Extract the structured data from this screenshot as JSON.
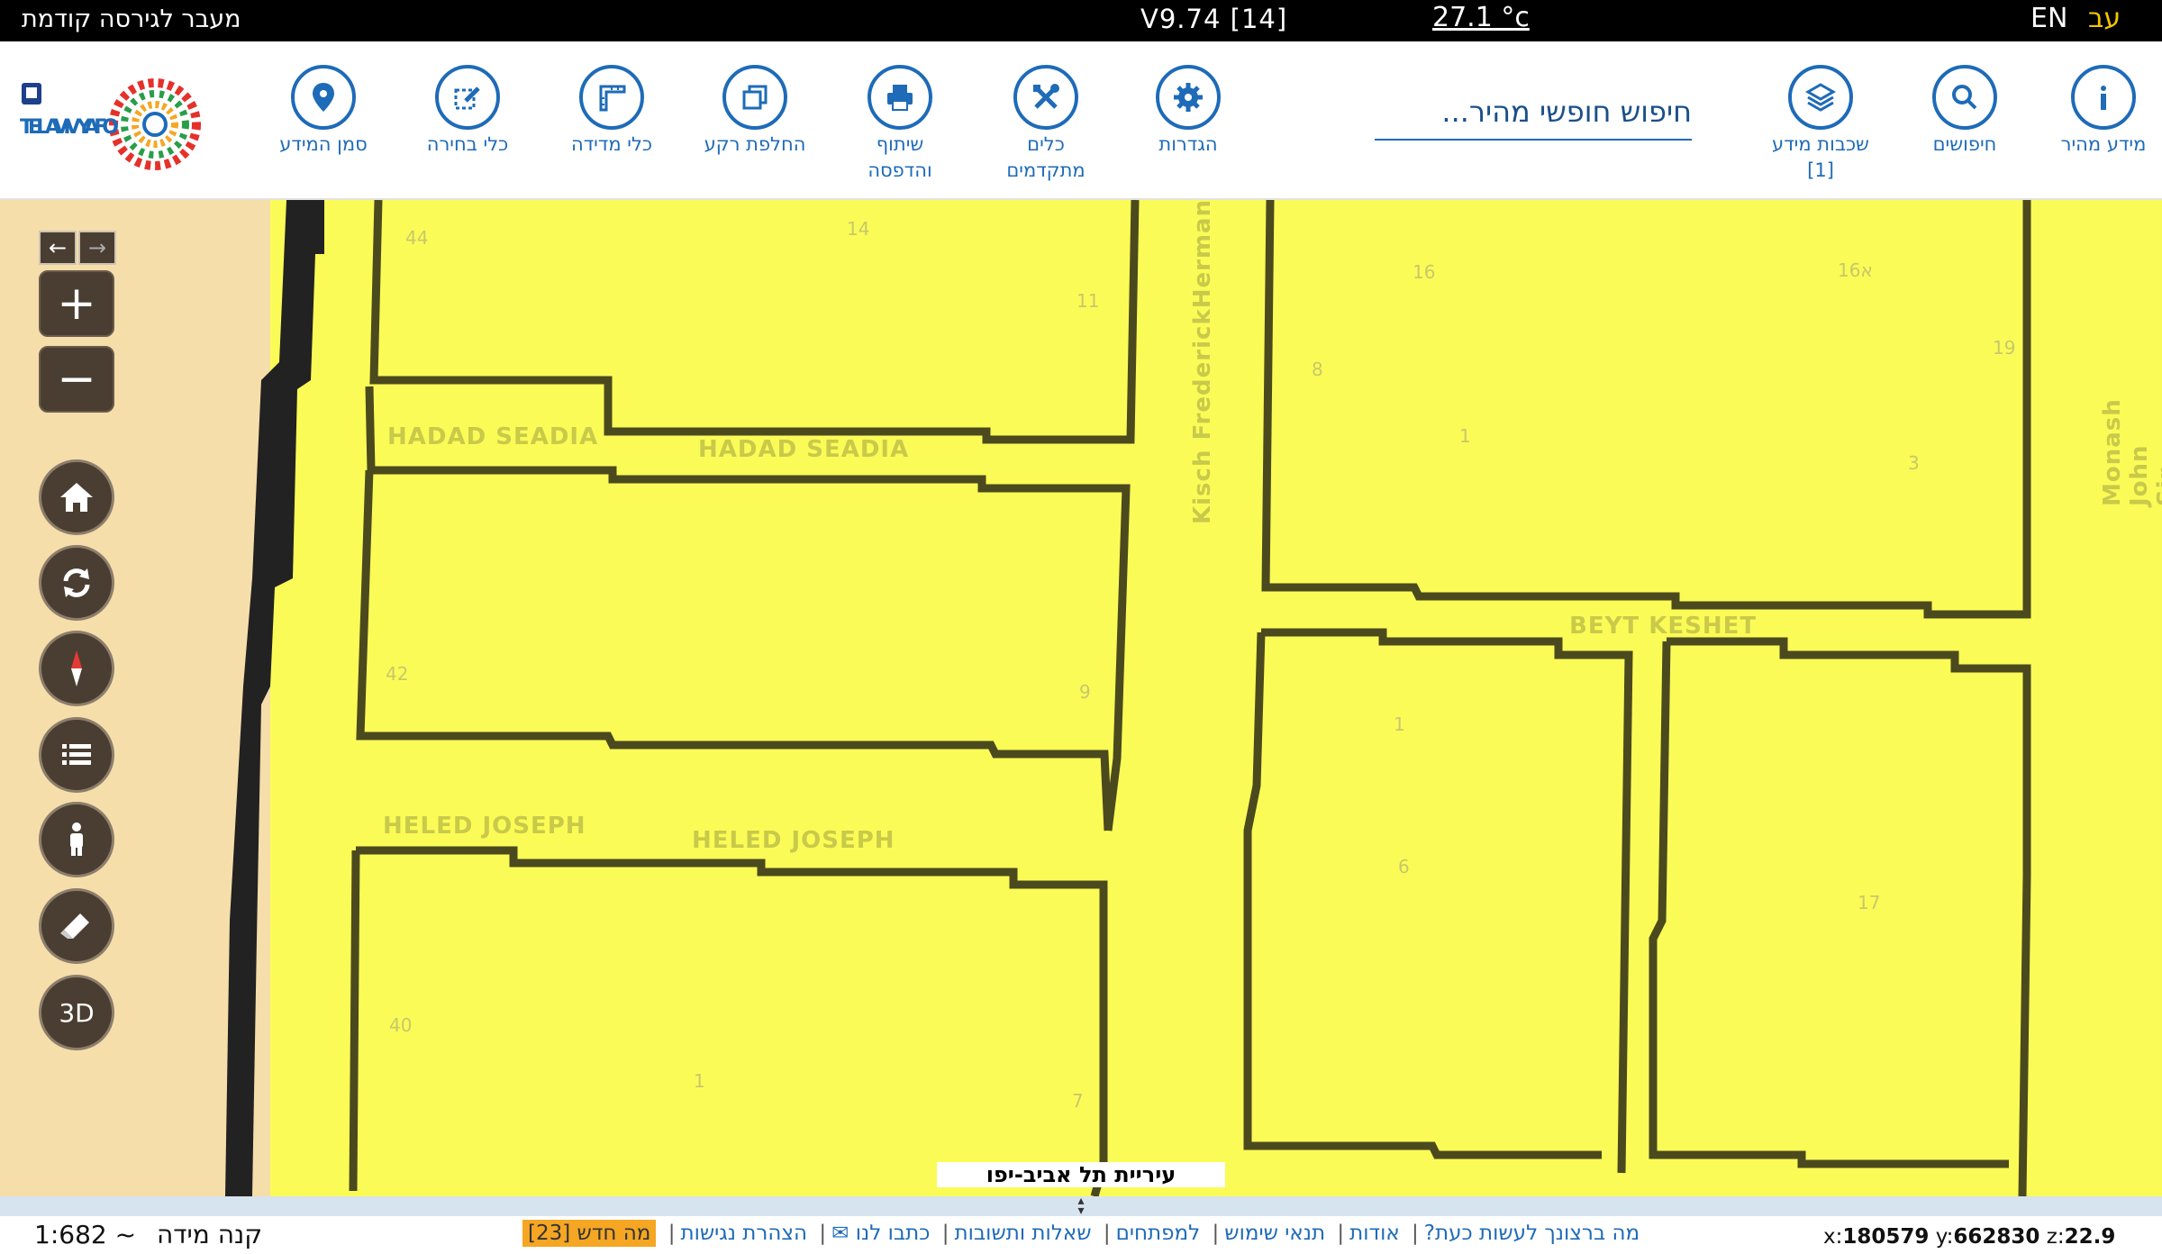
{
  "topbar": {
    "prev_version": "מעבר לגירסה קודמת",
    "version": "V9.74 [14]",
    "temperature": "27.1 °c",
    "lang_en": "EN",
    "lang_he": "עב"
  },
  "toolbar": {
    "logo_text": "TEL AVIV YAFO",
    "tools": {
      "quick_info": "מידע מהיר",
      "searches": "חיפושים",
      "layers": "שכבות מידע\n[1]",
      "settings": "הגדרות",
      "advanced": "כלים\nמתקדמים",
      "share_print": "שיתוף\nוהדפסה",
      "basemap": "החלפת רקע",
      "measure": "כלי מדידה",
      "select": "כלי בחירה",
      "marker": "סמן המידע"
    },
    "search_placeholder": "חיפוש חופשי מהיר..."
  },
  "map": {
    "streets": {
      "hadad1": "HADAD SEADIA",
      "hadad2": "HADAD SEADIA",
      "heled1": "HELED JOSEPH",
      "heled2": "HELED JOSEPH",
      "kisch": "Kisch FrederickHerman",
      "beyt": "BEYT KESHET",
      "monash": "Monash John Sir"
    },
    "parcel_numbers": [
      "44",
      "14",
      "11",
      "16",
      "16א",
      "19",
      "8",
      "1",
      "3",
      "42",
      "9",
      "1",
      "6",
      "17",
      "40",
      "1",
      "7"
    ],
    "city_label": "עיריית תל אביב-יפו"
  },
  "controls": {
    "zoom_in": "+",
    "zoom_out": "−",
    "three_d": "3D"
  },
  "footer": {
    "scale_label": "קנה מידה",
    "scale_value": "1:682 ~",
    "links": {
      "what_now": "מה ברצונך לעשות כעת?",
      "about": "אודות",
      "terms": "תנאי שימוש",
      "developers": "למפתחים",
      "faq": "שאלות ותשובות",
      "contact": "כתבו לנו ✉",
      "accessibility": "הצהרת נגישות",
      "whats_new": "מה חדש [23]"
    },
    "coords": {
      "x_label": "x:",
      "x": "180579",
      "y_label": "y:",
      "y": "662830",
      "z_label": "z:",
      "z": "22.9"
    }
  }
}
